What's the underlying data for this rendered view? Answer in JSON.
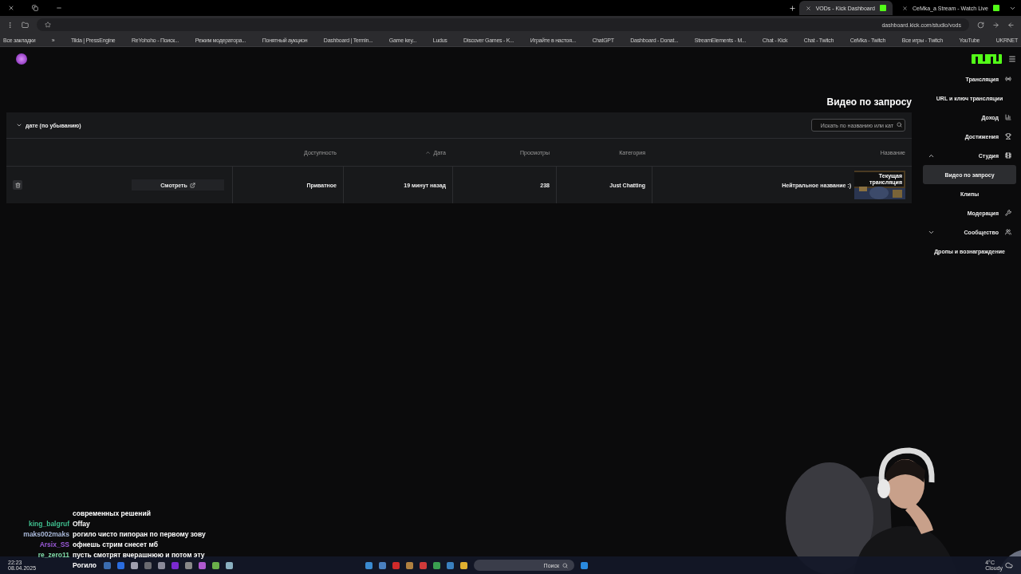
{
  "browser": {
    "tabs": [
      {
        "title": "VODs - Kick Dashboard",
        "selected": true
      },
      {
        "title": "CeMka_a Stream - Watch Live",
        "selected": false
      }
    ],
    "url": "dashboard.kick.com/studio/vods",
    "bookmarks": [
      "Все закладки",
      "»",
      "Tilda | PressEngine",
      "ReYohoho - Поиск...",
      "Режим модератора...",
      "Понятный аукцион",
      "Dashboard | Termin...",
      "Game key...",
      "Ludus",
      "Discover Games - K...",
      "Играйте в настоя...",
      "ChatGPT",
      "Dashboard - Donat...",
      "StreamElements - M...",
      "Chat - Kick",
      "Chat - Twitch",
      "CeMka - Twitch",
      "Все игры - Twitch",
      "YouTube",
      "UKRNET"
    ]
  },
  "sidebar": {
    "items": [
      {
        "label": "Трансляция",
        "kind": "item",
        "selected": false
      },
      {
        "label": "URL и ключ трансляции",
        "kind": "sub",
        "selected": false
      },
      {
        "label": "Доход",
        "kind": "item",
        "selected": false
      },
      {
        "label": "Достижения",
        "kind": "item",
        "selected": false
      },
      {
        "label": "Студия",
        "kind": "group",
        "expanded": true,
        "selected": false
      },
      {
        "label": "Видео по запросу",
        "kind": "sub",
        "selected": true
      },
      {
        "label": "Клипы",
        "kind": "sub",
        "selected": false
      },
      {
        "label": "Модерация",
        "kind": "item",
        "selected": false
      },
      {
        "label": "Сообщество",
        "kind": "group",
        "expanded": false,
        "selected": false
      },
      {
        "label": "Дропы и вознаграждение",
        "kind": "sub",
        "selected": false
      }
    ]
  },
  "page": {
    "title": "Видео по запросу",
    "sort": "дате (по убыванию)",
    "search": {
      "placeholder": "Искать по названию или кат"
    },
    "columns": [
      {
        "label": "Доступность",
        "sorted": false
      },
      {
        "label": "Дата",
        "sorted": true
      },
      {
        "label": "Просмотры",
        "sorted": false
      },
      {
        "label": "Категория",
        "sorted": false
      },
      {
        "label": "Название",
        "sorted": false
      }
    ],
    "rows": [
      {
        "action": "Смотреть",
        "visibility": "Приватное",
        "date": "19 минут назад",
        "views": "238",
        "category": "Just Chatting",
        "title": "Нейтральное название :)",
        "badge": "Текущая трансляция"
      }
    ]
  },
  "chat": [
    {
      "message": "современных решений"
    },
    {
      "user": "king_balgruf",
      "color": "#3fbf8f",
      "message": "Offay"
    },
    {
      "user": "maks002maks",
      "color": "#a9b8d8",
      "message": "рогило чисто пипоран по первому зову"
    },
    {
      "user": "Arsix_SS",
      "color": "#9a5ad8",
      "message": "офнешь стрим снесет мб"
    },
    {
      "user": "re_zero11",
      "color": "#7fd8a8",
      "message": "пусть смотрят вчерашнюю и потом эту"
    },
    {
      "message": "Рогило"
    }
  ],
  "taskbar": {
    "search": "Поиск",
    "time": "22:23",
    "date": "08.04.2025",
    "temperature": "4°C",
    "weather": "Cloudy"
  }
}
